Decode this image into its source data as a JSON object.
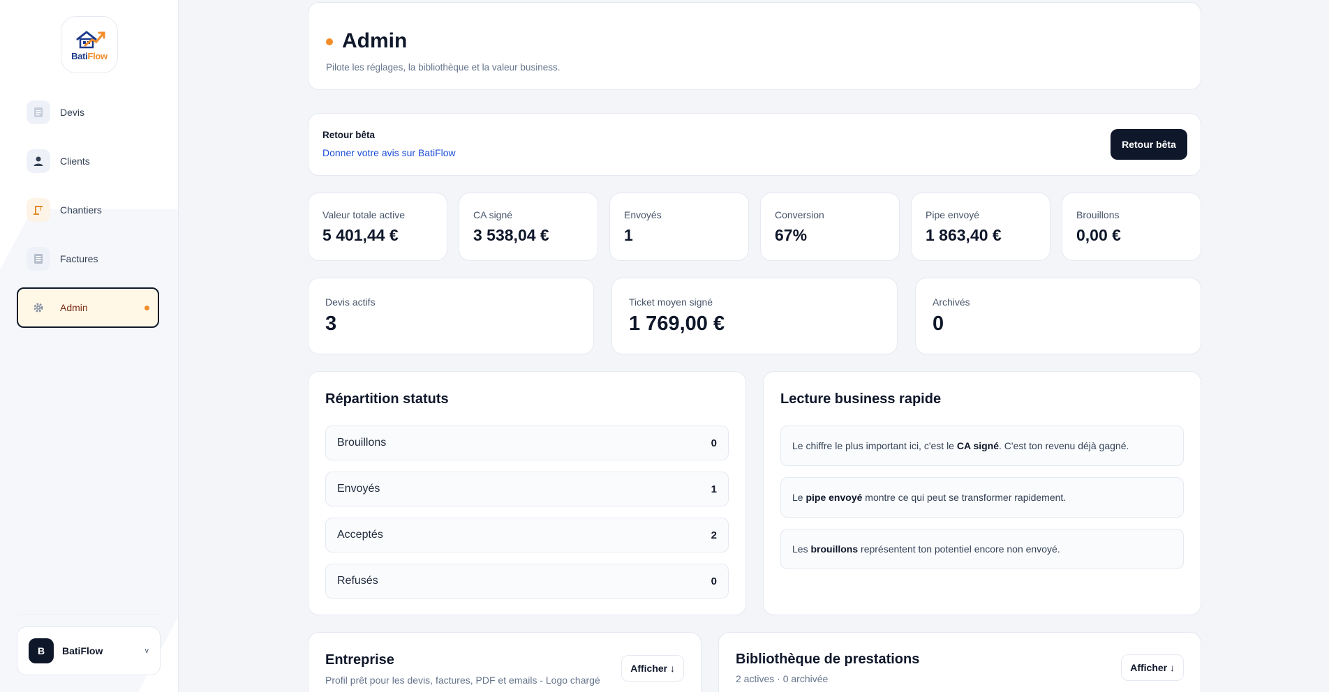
{
  "sidebar": {
    "logo": {
      "part1": "Bati",
      "part2": "Flow"
    },
    "items": [
      {
        "label": "Devis",
        "icon": "document-icon",
        "active": false
      },
      {
        "label": "Clients",
        "icon": "user-icon",
        "active": false
      },
      {
        "label": "Chantiers",
        "icon": "crane-icon",
        "active": false
      },
      {
        "label": "Factures",
        "icon": "invoice-icon",
        "active": false
      },
      {
        "label": "Admin",
        "icon": "gear-icon",
        "active": true
      }
    ],
    "user": {
      "initial": "B",
      "name": "BatiFlow",
      "chevron": "v"
    }
  },
  "header": {
    "title": "Admin",
    "subtitle": "Pilote les réglages, la bibliothèque et la valeur business."
  },
  "beta": {
    "title": "Retour bêta",
    "link": "Donner votre avis sur BatiFlow",
    "button": "Retour bêta"
  },
  "kpis": [
    {
      "label": "Valeur totale active",
      "value": "5 401,44 €"
    },
    {
      "label": "CA signé",
      "value": "3 538,04 €"
    },
    {
      "label": "Envoyés",
      "value": "1"
    },
    {
      "label": "Conversion",
      "value": "67%"
    },
    {
      "label": "Pipe envoyé",
      "value": "1 863,40 €"
    },
    {
      "label": "Brouillons",
      "value": "0,00 €"
    }
  ],
  "kpis2": [
    {
      "label": "Devis actifs",
      "value": "3"
    },
    {
      "label": "Ticket moyen signé",
      "value": "1 769,00 €"
    },
    {
      "label": "Archivés",
      "value": "0"
    }
  ],
  "status_panel": {
    "title": "Répartition statuts",
    "rows": [
      {
        "name": "Brouillons",
        "count": "0"
      },
      {
        "name": "Envoyés",
        "count": "1"
      },
      {
        "name": "Acceptés",
        "count": "2"
      },
      {
        "name": "Refusés",
        "count": "0"
      }
    ]
  },
  "business_panel": {
    "title": "Lecture business rapide",
    "rows": [
      {
        "pre": "Le chiffre le plus important ici, c'est le ",
        "bold": "CA signé",
        "post": ". C'est ton revenu déjà gagné."
      },
      {
        "pre": "Le ",
        "bold": "pipe envoyé",
        "post": " montre ce qui peut se transformer rapidement."
      },
      {
        "pre": "Les ",
        "bold": "brouillons",
        "post": " représentent ton potentiel encore non envoyé."
      }
    ]
  },
  "entreprise": {
    "title": "Entreprise",
    "subtitle": "Profil prêt pour les devis, factures, PDF et emails - Logo chargé",
    "button": "Afficher ↓"
  },
  "bibliotheque": {
    "title": "Bibliothèque de prestations",
    "subtitle": "2 actives · 0 archivée",
    "button": "Afficher ↓"
  },
  "colors": {
    "accent": "#f28c28",
    "dark": "#0f172a",
    "link": "#1d4ed8",
    "background": "#f3f5f9"
  }
}
